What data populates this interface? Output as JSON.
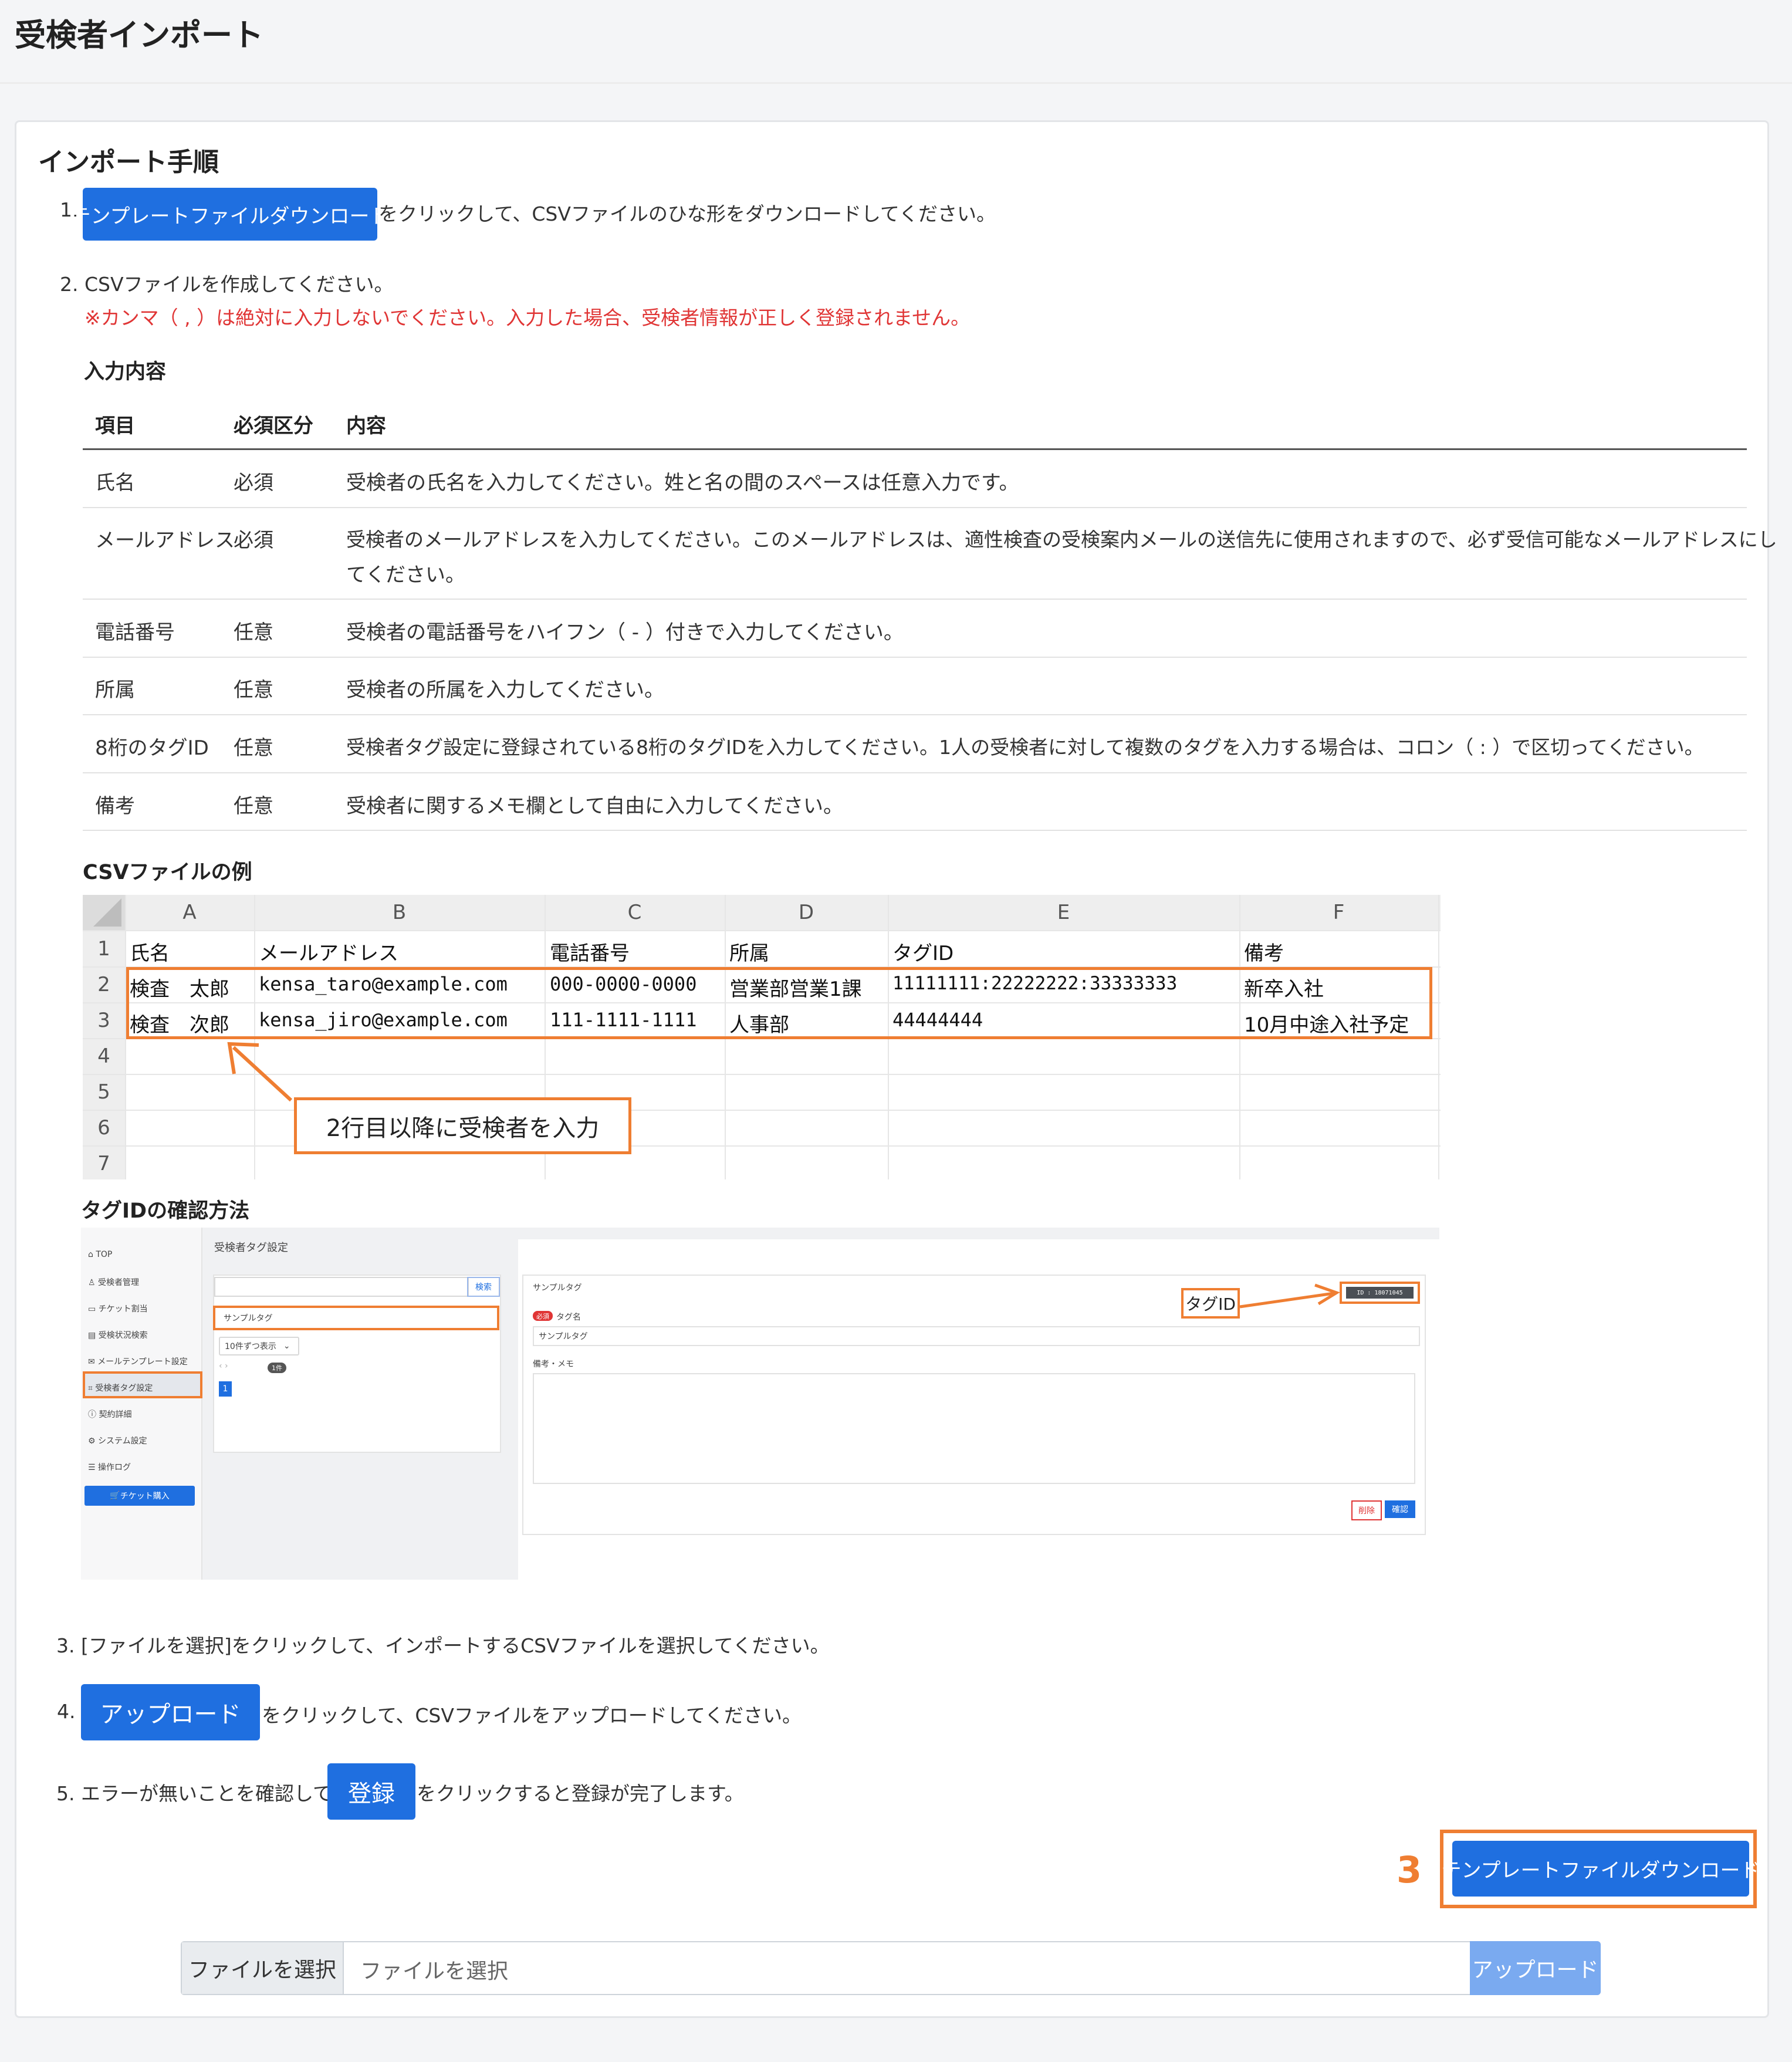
{
  "page_title": "受検者インポート",
  "section_title": "インポート手順",
  "steps": {
    "s1_num": "1.",
    "s1_button": "テンプレートファイルダウンロード",
    "s1_text": "をクリックして、CSVファイルのひな形をダウンロードしてください。",
    "s2_text": "2. CSVファイルを作成してください。",
    "s2_warning": "※カンマ（ , ）は絶対に入力しないでください。入力した場合、受検者情報が正しく登録されません。",
    "s3_text": "3. [ファイルを選択]をクリックして、インポートするCSVファイルを選択してください。",
    "s4_num": "4.",
    "s4_button": "アップロード",
    "s4_text": "をクリックして、CSVファイルをアップロードしてください。",
    "s5_text": "5. エラーが無いことを確認して、",
    "s5_button": "登録",
    "s5_text2": "をクリックすると登録が完了します。"
  },
  "input_section": {
    "title": "入力内容",
    "headers": [
      "項目",
      "必須区分",
      "内容"
    ],
    "rows": [
      {
        "item": "氏名",
        "req": "必須",
        "desc": "受検者の氏名を入力してください。姓と名の間のスペースは任意入力です。",
        "desc2": ""
      },
      {
        "item": "メールアドレス",
        "req": "必須",
        "desc": "受検者のメールアドレスを入力してください。このメールアドレスは、適性検査の受検案内メールの送信先に使用されますので、必ず受信可能なメールアドレスにし",
        "desc2": "てください。"
      },
      {
        "item": "電話番号",
        "req": "任意",
        "desc": "受検者の電話番号をハイフン（ - ）付きで入力してください。",
        "desc2": ""
      },
      {
        "item": "所属",
        "req": "任意",
        "desc": "受検者の所属を入力してください。",
        "desc2": ""
      },
      {
        "item": "8桁のタグID",
        "req": "任意",
        "desc": "受検者タグ設定に登録されている8桁のタグIDを入力してください。1人の受検者に対して複数のタグを入力する場合は、コロン（ : ）で区切ってください。",
        "desc2": ""
      },
      {
        "item": "備考",
        "req": "任意",
        "desc": "受検者に関するメモ欄として自由に入力してください。",
        "desc2": ""
      }
    ]
  },
  "csv_example": {
    "title": "CSVファイルの例",
    "columns": [
      "A",
      "B",
      "C",
      "D",
      "E",
      "F"
    ],
    "row_numbers": [
      "1",
      "2",
      "3",
      "4",
      "5",
      "6",
      "7"
    ],
    "header_row": [
      "氏名",
      "メールアドレス",
      "電話番号",
      "所属",
      "タグID",
      "備考"
    ],
    "row2": [
      "検査　太郎",
      "kensa_taro@example.com",
      "000-0000-0000",
      "営業部営業1課",
      "11111111:22222222:33333333",
      "新卒入社"
    ],
    "row3": [
      "検査　次郎",
      "kensa_jiro@example.com",
      "111-1111-1111",
      "人事部",
      "44444444",
      "10月中途入社予定"
    ],
    "callout": "2行目以降に受検者を入力"
  },
  "tag_section": {
    "title": "タグIDの確認方法",
    "mini": {
      "sidebar": [
        "TOP",
        "受検者管理",
        "チケット割当",
        "受検状況検索",
        "メールテンプレート設定",
        "受検者タグ設定",
        "契約詳細",
        "システム設定",
        "操作ログ"
      ],
      "sidebar_button": "チケット購入",
      "page_title": "受検者タグ設定",
      "search_button": "検索",
      "list_item": "サンプルタグ",
      "per_page": "10件ずつ表示",
      "count_badge": "1件",
      "page_num": "1",
      "detail_title": "サンプルタグ",
      "required_badge": "必須",
      "tag_name_label": "タグ名",
      "tag_name_value": "サンプルタグ",
      "memo_label": "備考・メモ",
      "id_badge": "ID : 18071045",
      "delete_button": "削除",
      "confirm_button": "確認",
      "callout": "タグID"
    }
  },
  "bottom": {
    "step_number": "3",
    "download_button": "テンプレートファイルダウンロード",
    "file_select_button": "ファイルを選択",
    "file_placeholder": "ファイルを選択",
    "upload_button": "アップロード"
  },
  "colors": {
    "primary": "#1f6fe0",
    "warning": "#e03535",
    "highlight": "#ef7e32",
    "upload_disabled": "#7aaaf0"
  }
}
